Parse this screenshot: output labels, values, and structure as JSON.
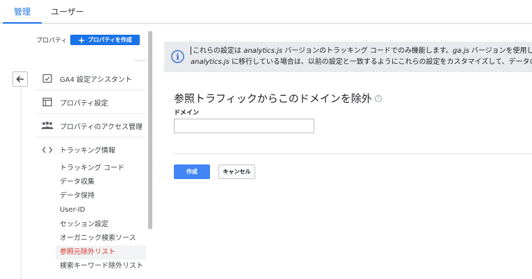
{
  "tabs": {
    "admin": "管理",
    "users": "ユーザー"
  },
  "sidebar": {
    "property_label": "プロパティ",
    "create_property": "プロパティを作成",
    "nav": [
      {
        "label": "GA4 設定アシスタント",
        "icon": "checklist-icon"
      },
      {
        "label": "プロパティ設定",
        "icon": "window-icon"
      },
      {
        "label": "プロパティのアクセス管理",
        "icon": "people-icon"
      },
      {
        "label": "トラッキング情報",
        "icon": "code-icon"
      }
    ],
    "tracking_items": [
      "トラッキング コード",
      "データ収集",
      "データ保持",
      "User-ID",
      "セッション設定",
      "オーガニック検索ソース",
      "参照元除外リスト",
      "検索キーワード除外リスト"
    ],
    "active_item": "参照元除外リスト"
  },
  "banner": {
    "line1_a": "これらの設定は ",
    "line1_b": "analytics.js",
    "line1_c": " バージョンのトラッキング コードでのみ機能します。",
    "line1_d": "ga.js",
    "line1_e": " バージョンを使用している場",
    "line2_a": "analytics.js",
    "line2_b": " に移行している場合は、以前の設定と一致するようにこれらの設定をカスタマイズして、データの連続性"
  },
  "form": {
    "title": "参照トラフィックからこのドメインを除外",
    "domain_label": "ドメイン",
    "domain_value": "",
    "submit": "作成",
    "cancel": "キャンセル"
  },
  "colors": {
    "accent": "#1a73e8",
    "active_text": "#d93025",
    "button_blue": "#4285f4"
  }
}
